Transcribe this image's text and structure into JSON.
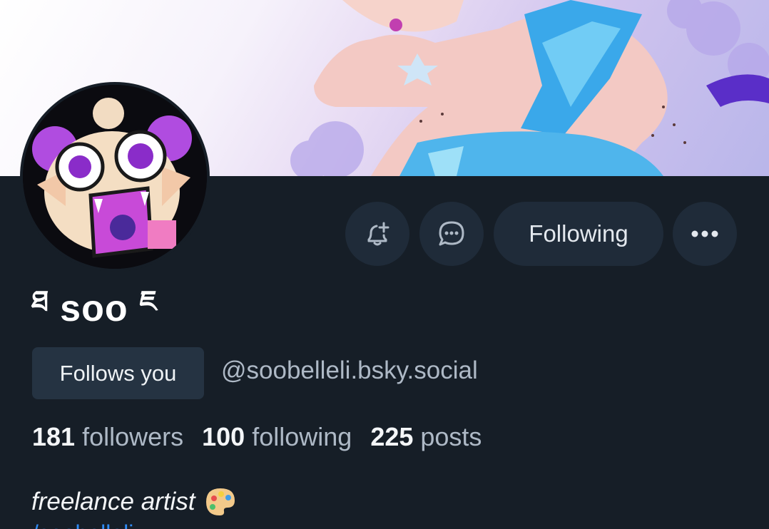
{
  "profile": {
    "display_name": "soo",
    "name_prefix_glyph": "ཐ",
    "name_suffix_glyph": "ཇ",
    "follows_you_label": "Follows you",
    "handle": "@soobelleli.bsky.social",
    "bio": "freelance artist",
    "bio_emoji": "palette-emoji",
    "bio_link_partial": "/soobelleli"
  },
  "actions": {
    "subscribe_icon": "bell-plus-icon",
    "message_icon": "chat-bubble-icon",
    "following_label": "Following",
    "more_icon": "ellipsis-icon"
  },
  "stats": {
    "followers_count": "181",
    "followers_label": "followers",
    "following_count": "100",
    "following_label": "following",
    "posts_count": "225",
    "posts_label": "posts"
  },
  "colors": {
    "background": "#161e27",
    "button_bg": "#1f2b39",
    "badge_bg": "#253342",
    "secondary_text": "#aeb9c6",
    "link": "#2f8bf5"
  }
}
